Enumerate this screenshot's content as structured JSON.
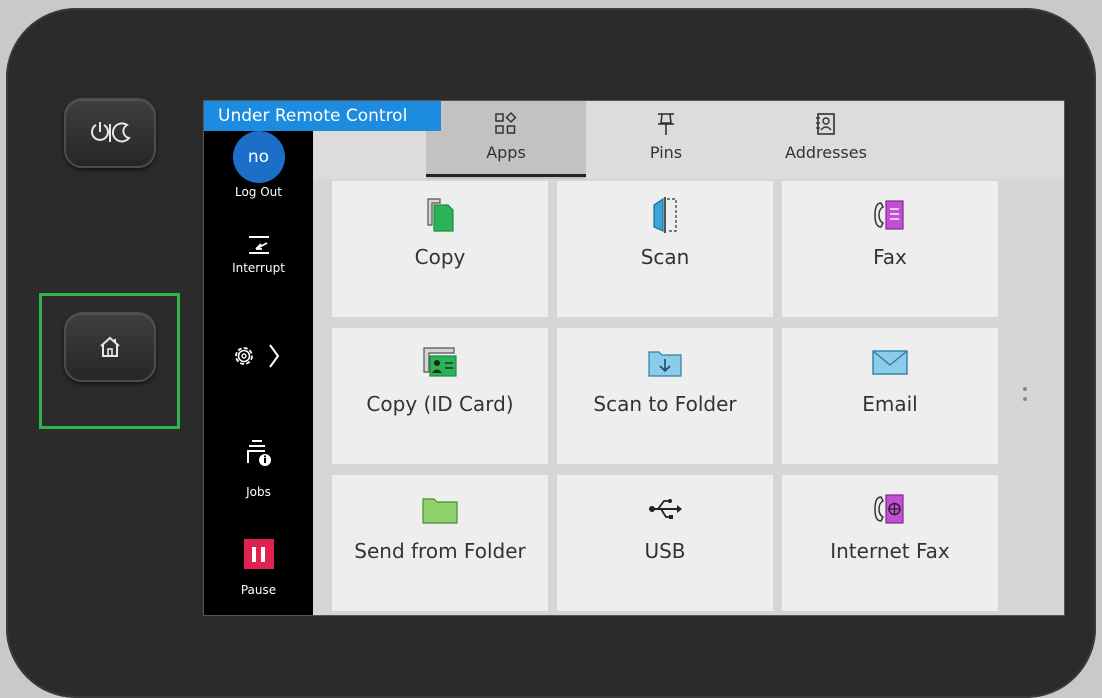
{
  "hardware": {
    "power_icon": "power-sleep-icon",
    "home_icon": "home-icon"
  },
  "banner": {
    "text": "Under Remote Control"
  },
  "sidebar": {
    "user_initials": "no",
    "logout_label": "Log Out",
    "interrupt_label": "Interrupt",
    "settings_icon": "gear-icon",
    "jobs_label": "Jobs",
    "pause_label": "Pause"
  },
  "tabs": [
    {
      "label": "Apps",
      "icon": "apps-icon",
      "active": true
    },
    {
      "label": "Pins",
      "icon": "pin-icon",
      "active": false
    },
    {
      "label": "Addresses",
      "icon": "address-book-icon",
      "active": false
    }
  ],
  "apps": [
    {
      "label": "Copy",
      "icon": "copy-icon"
    },
    {
      "label": "Scan",
      "icon": "scan-icon"
    },
    {
      "label": "Fax",
      "icon": "fax-icon"
    },
    {
      "label": "Copy (ID Card)",
      "icon": "id-card-icon"
    },
    {
      "label": "Scan to Folder",
      "icon": "scan-folder-icon"
    },
    {
      "label": "Email",
      "icon": "email-icon"
    },
    {
      "label": "Send from Folder",
      "icon": "folder-icon"
    },
    {
      "label": "USB",
      "icon": "usb-icon"
    },
    {
      "label": "Internet Fax",
      "icon": "internet-fax-icon"
    }
  ],
  "colors": {
    "highlight": "#2fb44a",
    "banner": "#1d8ce0",
    "pause": "#e0224e",
    "copy_green": "#2bb357",
    "scan_blue": "#3aa6d8",
    "fax_purple": "#c34fd6",
    "folder_green": "#8fd16a"
  }
}
